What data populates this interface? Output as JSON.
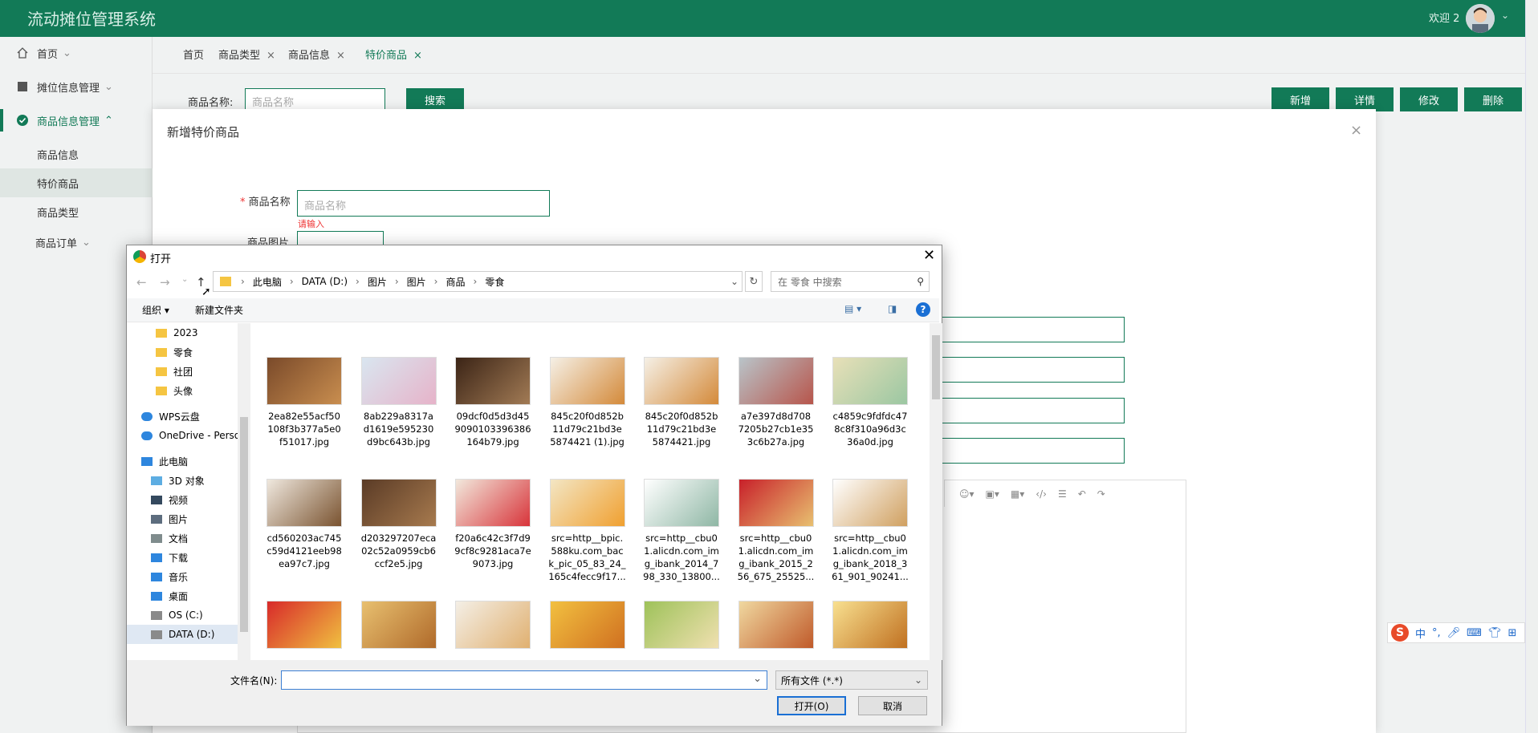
{
  "app": {
    "title": "流动摊位管理系统",
    "welcome": "欢迎 2"
  },
  "sidebar": {
    "items": [
      {
        "label": "首页",
        "icon": "home-icon"
      },
      {
        "label": "摊位信息管理",
        "icon": "stall-icon"
      },
      {
        "label": "商品信息管理",
        "icon": "check-circle-icon"
      },
      {
        "label": "商品订单",
        "icon": ""
      }
    ],
    "sub_items": [
      "商品信息",
      "特价商品",
      "商品类型"
    ]
  },
  "tabs": [
    {
      "label": "首页",
      "closable": false
    },
    {
      "label": "商品类型",
      "closable": true
    },
    {
      "label": "商品信息",
      "closable": true
    },
    {
      "label": "特价商品",
      "closable": true,
      "active": true
    }
  ],
  "search": {
    "label": "商品名称:",
    "placeholder": "商品名称",
    "button": "搜索"
  },
  "actions": [
    "新增",
    "详情",
    "修改",
    "删除"
  ],
  "modal": {
    "title": "新增特价商品",
    "name_label": "商品名称",
    "name_placeholder": "商品名称",
    "name_error": "请输入",
    "image_label": "商品图片"
  },
  "dialog": {
    "title": "打开",
    "path": [
      "此电脑",
      "DATA (D:)",
      "图片",
      "图片",
      "商品",
      "零食"
    ],
    "search_placeholder": "在 零食 中搜索",
    "organize": "组织",
    "new_folder": "新建文件夹",
    "tree": [
      {
        "label": "2023",
        "type": "folder"
      },
      {
        "label": "零食",
        "type": "folder"
      },
      {
        "label": "社团",
        "type": "folder"
      },
      {
        "label": "头像",
        "type": "folder"
      },
      {
        "label": "WPS云盘",
        "type": "cloud"
      },
      {
        "label": "OneDrive - Perso",
        "type": "cloud"
      },
      {
        "label": "此电脑",
        "type": "pc"
      },
      {
        "label": "3D 对象",
        "type": "3d"
      },
      {
        "label": "视频",
        "type": "video"
      },
      {
        "label": "图片",
        "type": "picture"
      },
      {
        "label": "文档",
        "type": "doc"
      },
      {
        "label": "下载",
        "type": "download"
      },
      {
        "label": "音乐",
        "type": "music"
      },
      {
        "label": "桌面",
        "type": "desktop"
      },
      {
        "label": "OS (C:)",
        "type": "drive"
      },
      {
        "label": "DATA (D:)",
        "type": "drive",
        "selected": true
      }
    ],
    "files": [
      {
        "name": "2ea82e55acf50 108f3b377a5e0 f51017.jpg",
        "colors": [
          "#7a4a2a",
          "#c98e4f"
        ]
      },
      {
        "name": "8ab229a8317a d1619e595230 d9bc643b.jpg",
        "colors": [
          "#d9e6f0",
          "#e6b3c9"
        ]
      },
      {
        "name": "09dcf0d5d3d45 9090103396386 164b79.jpg",
        "colors": [
          "#3b2416",
          "#a27b55"
        ]
      },
      {
        "name": "845c20f0d852b 11d79c21bd3e 5874421 (1).jpg",
        "colors": [
          "#f5f0e6",
          "#d48a3a"
        ]
      },
      {
        "name": "845c20f0d852b 11d79c21bd3e 5874421.jpg",
        "colors": [
          "#f5f0e6",
          "#d48a3a"
        ]
      },
      {
        "name": "a7e397d8d708 7205b27cb1e35 3c6b27a.jpg",
        "colors": [
          "#b9c4c9",
          "#b7554b"
        ]
      },
      {
        "name": "c4859c9fdfdc47 8c8f310a96d3c 36a0d.jpg",
        "colors": [
          "#e8e0b8",
          "#9bc7a2"
        ]
      },
      {
        "name": "cd560203ac745 c59d4121eeb98 ea97c7.jpg",
        "colors": [
          "#efe8de",
          "#7a5330"
        ]
      },
      {
        "name": "d203297207eca 02c52a0959cb6 ccf2e5.jpg",
        "colors": [
          "#5a3b26",
          "#a77a4e"
        ]
      },
      {
        "name": "f20a6c42c3f7d9 9cf8c9281aca7e 9073.jpg",
        "colors": [
          "#f2e8dc",
          "#d8343a"
        ]
      },
      {
        "name": "src=http__bpic. 588ku.com_bac k_pic_05_83_24_ 165c4fecc9f17...",
        "colors": [
          "#f3e6c4",
          "#f0a030"
        ]
      },
      {
        "name": "src=http__cbu0 1.alicdn.com_im g_ibank_2014_7 98_330_13800...",
        "colors": [
          "#ffffff",
          "#8fb7a5"
        ]
      },
      {
        "name": "src=http__cbu0 1.alicdn.com_im g_ibank_2015_2 56_675_25525...",
        "colors": [
          "#c8202a",
          "#e8c070"
        ]
      },
      {
        "name": "src=http__cbu0 1.alicdn.com_im g_ibank_2018_3 61_901_90241...",
        "colors": [
          "#ffffff",
          "#d0a060"
        ]
      },
      {
        "name": "",
        "colors": [
          "#d82a2a",
          "#f0c040"
        ]
      },
      {
        "name": "",
        "colors": [
          "#e8c070",
          "#b06a2a"
        ]
      },
      {
        "name": "",
        "colors": [
          "#f4efe6",
          "#e0b070"
        ]
      },
      {
        "name": "",
        "colors": [
          "#f2c040",
          "#d07020"
        ]
      },
      {
        "name": "",
        "colors": [
          "#9ec25a",
          "#f0e0b0"
        ]
      },
      {
        "name": "",
        "colors": [
          "#f0d8a0",
          "#c05a2a"
        ]
      },
      {
        "name": "",
        "colors": [
          "#f8e090",
          "#c07020"
        ]
      }
    ],
    "filename_label": "文件名(N):",
    "filetype": "所有文件 (*.*)",
    "open_button": "打开(O)",
    "cancel_button": "取消"
  },
  "ime": {
    "label": "中"
  },
  "colors": {
    "primary": "#127a57",
    "error": "#e33333",
    "dialog_accent": "#1a6fd4"
  }
}
